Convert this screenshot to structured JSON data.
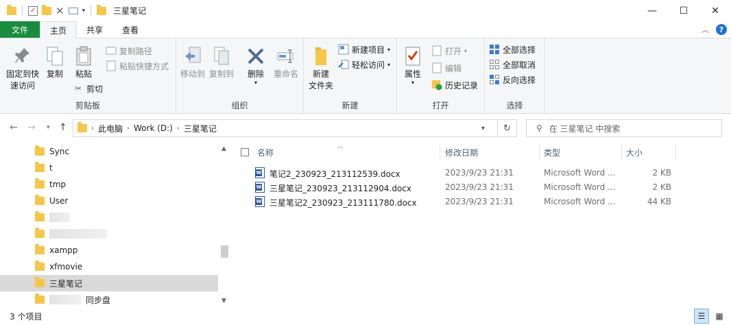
{
  "window": {
    "title": "三星笔记",
    "minimize": "—",
    "maximize": "☐",
    "close": "✕"
  },
  "tabs": [
    "文件",
    "主页",
    "共享",
    "查看"
  ],
  "ribbon": {
    "clipboard": {
      "label": "剪贴板",
      "pin_line1": "固定到快",
      "pin_line2": "速访问",
      "copy": "复制",
      "paste": "粘贴",
      "copy_path": "复制路径",
      "paste_shortcut": "粘贴快捷方式",
      "cut": "剪切"
    },
    "organize": {
      "label": "组织",
      "move_to": "移动到",
      "copy_to": "复制到",
      "delete": "删除",
      "rename": "重命名"
    },
    "new": {
      "label": "新建",
      "new_folder_line1": "新建",
      "new_folder_line2": "文件夹",
      "new_item": "新建项目",
      "easy_access": "轻松访问"
    },
    "open": {
      "label": "打开",
      "properties": "属性",
      "open": "打开",
      "edit": "编辑",
      "history": "历史记录"
    },
    "select": {
      "label": "选择",
      "select_all": "全部选择",
      "select_none": "全部取消",
      "invert": "反向选择"
    }
  },
  "address": {
    "crumbs": [
      "此电脑",
      "Work (D:)",
      "三星笔记"
    ],
    "search_placeholder": "在 三星笔记 中搜索"
  },
  "nav_items": [
    {
      "label": "Sync"
    },
    {
      "label": "t"
    },
    {
      "label": "tmp"
    },
    {
      "label": "User"
    },
    {
      "label": ""
    },
    {
      "label": ""
    },
    {
      "label": "xampp"
    },
    {
      "label": "xfmovie"
    },
    {
      "label": "三星笔记"
    },
    {
      "label": "同步盘"
    }
  ],
  "columns": [
    "名称",
    "修改日期",
    "类型",
    "大小"
  ],
  "files": [
    {
      "name": "笔记2_230923_213112539.docx",
      "date": "2023/9/23 21:31",
      "type": "Microsoft Word ...",
      "size": "2 KB"
    },
    {
      "name": "三星笔记_230923_213112904.docx",
      "date": "2023/9/23 21:31",
      "type": "Microsoft Word ...",
      "size": "2 KB"
    },
    {
      "name": "三星笔记2_230923_213111780.docx",
      "date": "2023/9/23 21:31",
      "type": "Microsoft Word ...",
      "size": "44 KB"
    }
  ],
  "status": {
    "count": "3 个项目"
  }
}
